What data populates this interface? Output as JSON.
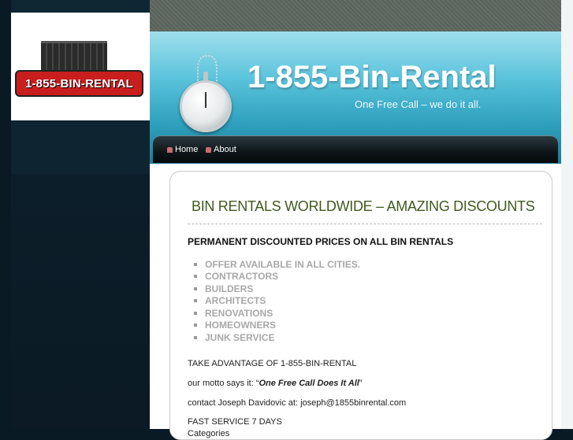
{
  "logo": {
    "text": "1-855-BIN-RENTAL"
  },
  "header": {
    "title": "1-855-Bin-Rental",
    "tagline": "One Free Call – we do it all."
  },
  "nav": {
    "items": [
      {
        "label": "Home"
      },
      {
        "label": "About"
      }
    ]
  },
  "post": {
    "title": "BIN RENTALS WORLDWIDE – AMAZING DISCOUNTS",
    "subhead": "PERMANENT DISCOUNTED PRICES ON ALL BIN RENTALS",
    "bullets": [
      "OFFER AVAILABLE IN ALL CITIES.",
      "CONTRACTORS",
      "BUILDERS",
      "ARCHITECTS",
      "RENOVATIONS",
      "HOMEOWNERS",
      "JUNK SERVICE"
    ],
    "advantage": "TAKE ADVANTAGE OF 1-855-BIN-RENTAL",
    "motto_prefix": "our motto says it: “",
    "motto_text": "One Free Call Does It All",
    "motto_suffix": "”",
    "contact": "contact  Joseph Davidovic at: joseph@1855binrental.com",
    "service": "FAST SERVICE 7 DAYS",
    "categories": "Categories"
  }
}
